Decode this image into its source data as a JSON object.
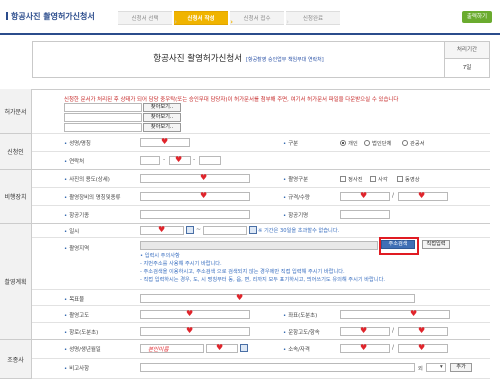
{
  "page": {
    "title": "항공사진 촬영허가신청서"
  },
  "steps": [
    "신청서 선택",
    "신청서 작성",
    "신청서 접수",
    "신청완료"
  ],
  "print_button": "출력하기",
  "form_header": {
    "title": "항공사진 촬영허가신청서",
    "subtitle": "[항공촬영 승인업무 책임부대 연락처]",
    "period_label": "처리기간",
    "period_value": "7일"
  },
  "attachments": {
    "label": "허가문서",
    "notice": "신청한 문서가 처리된 후 상태가 되어 담당 중우탁(또는 승인무대 담당자)이 허가문서를 첨부해 주면, 여기서 허가문서 파일을 다운받으실 수 있습니다",
    "find_button": "찾아보기.."
  },
  "applicant": {
    "label": "신청인",
    "name_label": "성명/명칭",
    "category_label": "구분",
    "category_options": [
      "개인",
      "법인단체",
      "관공서"
    ],
    "category_selected": "개인",
    "phone_label": "연락처"
  },
  "purpose": {
    "label": "비행장치",
    "use_label": "사진의 용도(상세)",
    "type_label": "촬영구분",
    "type_options": [
      "정사진",
      "사각",
      "동영상"
    ],
    "equipment_label": "촬영장비의 명칭및종류",
    "spec_label": "규격/수량",
    "aircraft_label": "항공기종",
    "flyer_label": "항공기명"
  },
  "filming": {
    "label": "촬영계획",
    "datetime_label": "일시",
    "datetime_note": "※ 기간은 30일을 초과할수 없습니다.",
    "area_label": "촬영지역",
    "address_search_button": "주소검색",
    "direct_input_button": "직접입력",
    "notes": [
      "• 입력시 주의사항",
      "- 지번주소를 사용해 주시기 바랍니다.",
      "- 주소검색을 이용하시고, 주소검색 으로 검색되지 않는 경우에만 직접 입력해 주시기 바랍니다.",
      "- 직접 입력하시는 경우, 도, 시 명칭부터 동, 읍, 면, 리까지 모두 표기하시고, 띄어쓰기도 유의해 주시기 바랍니다."
    ],
    "target_label": "목표물",
    "altitude_label": "촬영고도",
    "coords_label": "좌표(도분초)",
    "route_label": "항로(도분초)",
    "flight_label": "운항고도/항속"
  },
  "pilot": {
    "label": "조종사",
    "name_label": "성명/생년월일",
    "name_sample": "본인이름",
    "license_label": "소속/자격",
    "remarks_label": "비고사항",
    "remarks_suffix": "외",
    "add_button": "추가"
  }
}
